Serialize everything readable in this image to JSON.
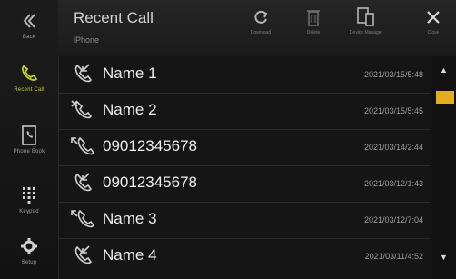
{
  "sidebar": {
    "back_label": "Back",
    "items": [
      {
        "label": "Recent Call",
        "icon": "recent-call-icon"
      },
      {
        "label": "Phone Book",
        "icon": "phone-book-icon"
      },
      {
        "label": "Keypad",
        "icon": "keypad-icon"
      },
      {
        "label": "Setup",
        "icon": "setup-icon"
      }
    ]
  },
  "header": {
    "title": "Recent Call",
    "subtitle": "iPhone",
    "buttons": [
      {
        "label": "Download",
        "icon": "refresh-icon"
      },
      {
        "label": "Delete",
        "icon": "trash-icon"
      },
      {
        "label": "Device Manager",
        "icon": "devices-icon"
      },
      {
        "label": "Close",
        "icon": "close-icon"
      }
    ]
  },
  "calls": [
    {
      "name": "Name 1",
      "time": "2021/03/15/5:48",
      "type": "incoming"
    },
    {
      "name": "Name 2",
      "time": "2021/03/15/5:45",
      "type": "missed"
    },
    {
      "name": "09012345678",
      "time": "2021/03/14/2:44",
      "type": "outgoing"
    },
    {
      "name": "09012345678",
      "time": "2021/03/12/1:43",
      "type": "incoming"
    },
    {
      "name": "Name 3",
      "time": "2021/03/12/7:04",
      "type": "outgoing"
    },
    {
      "name": "Name 4",
      "time": "2021/03/11/4:52",
      "type": "incoming"
    }
  ],
  "colors": {
    "accent": "#c8d21e",
    "scroll_thumb": "#e3ad1b",
    "background": "#151515"
  }
}
